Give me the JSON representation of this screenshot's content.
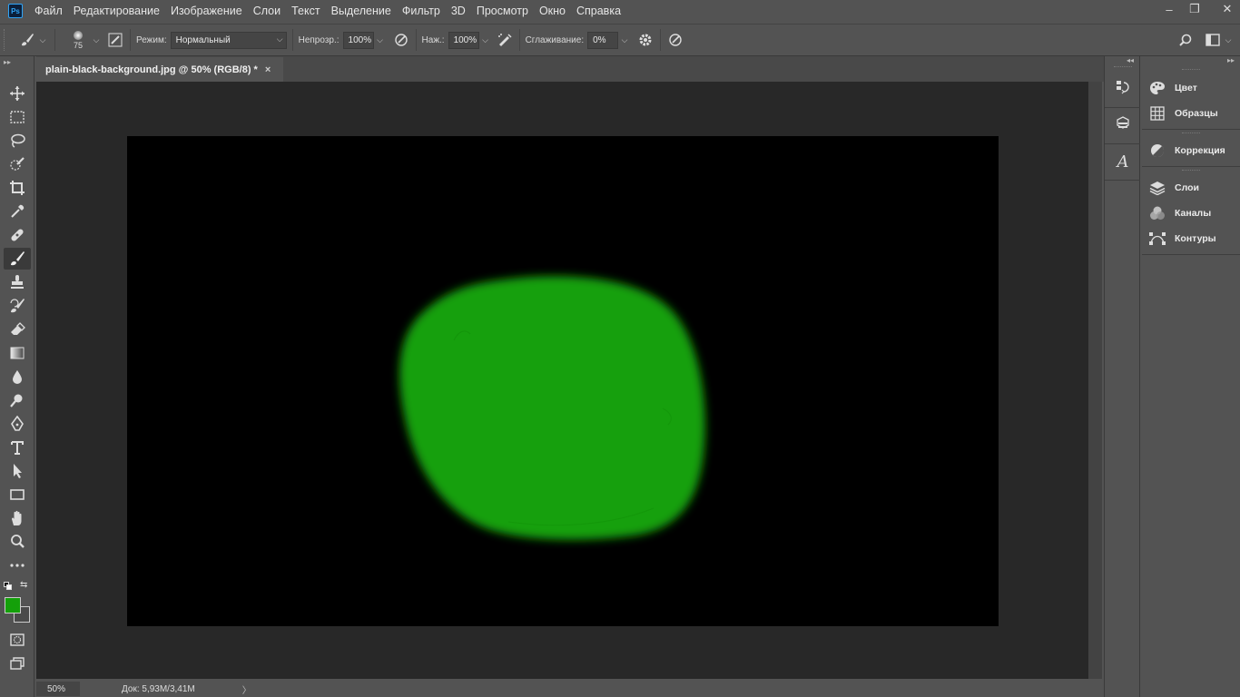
{
  "menubar": {
    "logo": "Ps",
    "items": [
      "Файл",
      "Редактирование",
      "Изображение",
      "Слои",
      "Текст",
      "Выделение",
      "Фильтр",
      "3D",
      "Просмотр",
      "Окно",
      "Справка"
    ],
    "window_controls": {
      "minimize": "–",
      "restore": "❐",
      "close": "✕"
    }
  },
  "options": {
    "brush_size": "75",
    "mode_label": "Режим:",
    "mode_value": "Нормальный",
    "opacity_label": "Непрозр.:",
    "opacity_value": "100%",
    "pressure_label": "Наж.:",
    "pressure_value": "100%",
    "smoothing_label": "Сглаживание:",
    "smoothing_value": "0%"
  },
  "document": {
    "tab_title": "plain-black-background.jpg @ 50% (RGB/8) *",
    "close": "×",
    "canvas_color": "#000000",
    "blob_color": "#14a00a"
  },
  "status": {
    "zoom": "50%",
    "doc_info": "Док: 5,93M/3,41M",
    "arrow": "〉"
  },
  "colors": {
    "foreground": "#14a00a",
    "background": "#4a4a4a",
    "ui_bg": "#535353",
    "pasteboard": "#282828"
  },
  "panels": {
    "items": [
      "Цвет",
      "Образцы",
      "Коррекция",
      "Слои",
      "Каналы",
      "Контуры"
    ]
  }
}
